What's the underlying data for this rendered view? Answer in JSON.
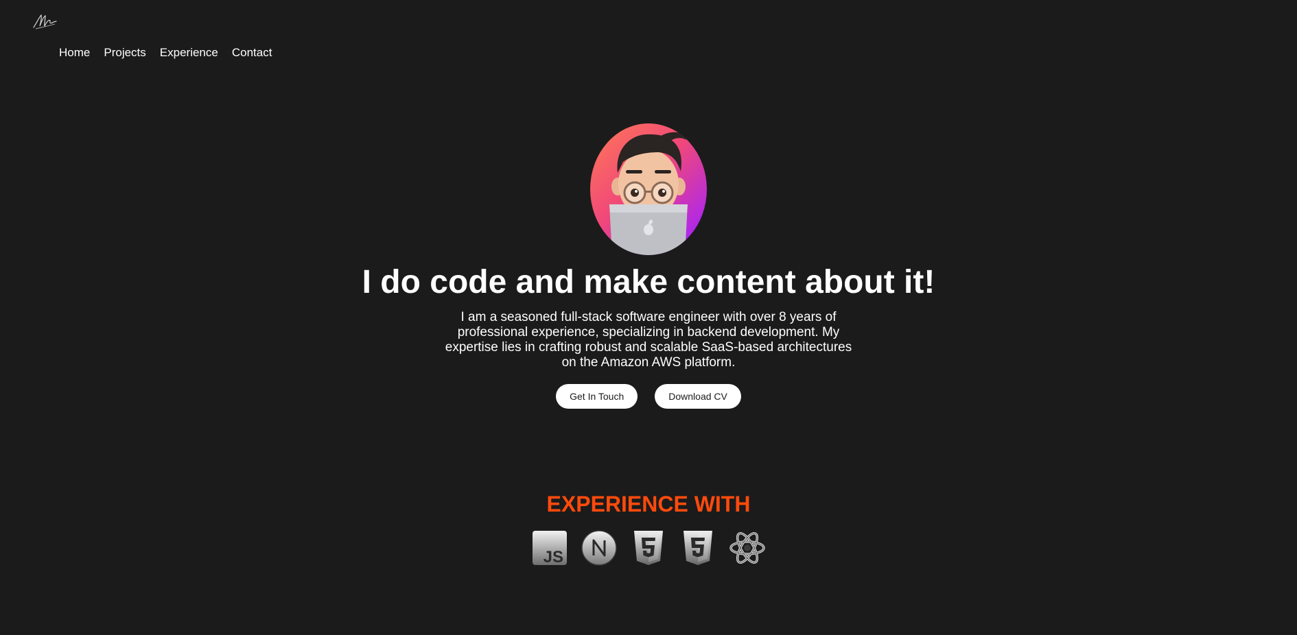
{
  "nav": {
    "items": [
      {
        "label": "Home"
      },
      {
        "label": "Projects"
      },
      {
        "label": "Experience"
      },
      {
        "label": "Contact"
      }
    ]
  },
  "hero": {
    "headline": "I do code and make content about it!",
    "bio": "I am a seasoned full-stack software engineer with over 8 years of professional experience, specializing in backend development. My expertise lies in crafting robust and scalable SaaS-based architectures on the Amazon AWS platform.",
    "buttons": {
      "contact_label": "Get In Touch",
      "cv_label": "Download CV"
    }
  },
  "experience": {
    "title": "EXPERIENCE WITH",
    "title_color": "#ff4a0c",
    "icons": [
      "javascript-icon",
      "nextjs-icon",
      "html5-icon",
      "css3-icon",
      "react-icon"
    ]
  },
  "colors": {
    "background": "#1b1b1b",
    "text": "#ffffff",
    "button_bg": "#ffffff",
    "button_text": "#1b1b1b"
  }
}
